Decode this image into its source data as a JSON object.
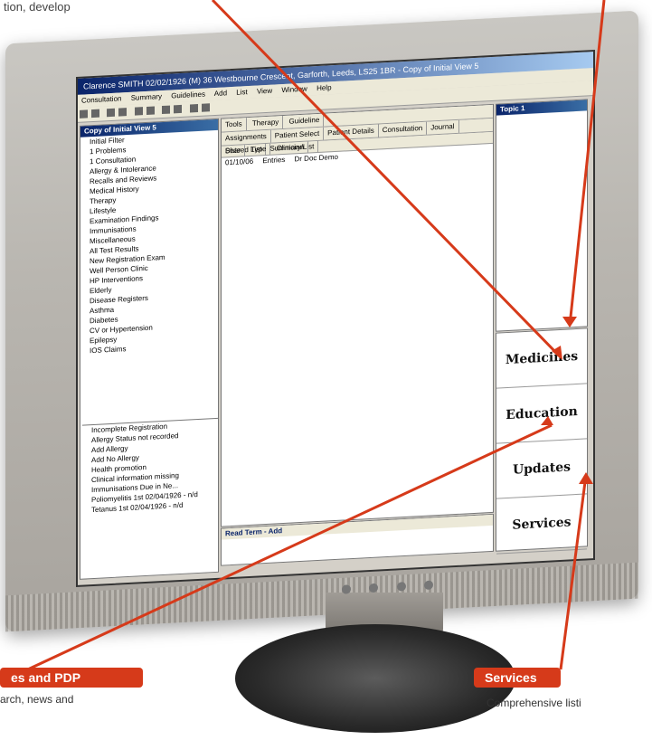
{
  "top_caption": "tion, develop",
  "window": {
    "title": "Clarence SMITH 02/02/1926 (M) 36 Westbourne Crescent, Garforth, Leeds, LS25 1BR - Copy of Initial View 5"
  },
  "menu": [
    "Consultation",
    "Summary",
    "Guidelines",
    "Add",
    "List",
    "View",
    "Window",
    "Help"
  ],
  "left_pane": {
    "title": "Copy of Initial View 5",
    "items": [
      "Initial Filter",
      "1 Problems",
      "1 Consultation",
      "Allergy & Intolerance",
      "Recalls and Reviews",
      "Medical History",
      "Therapy",
      "Lifestyle",
      "Examination Findings",
      "Immunisations",
      "Miscellaneous",
      "All Test Results",
      "New Registration Exam",
      "Well Person Clinic",
      "HP Interventions",
      "Elderly",
      "Disease Registers",
      "Asthma",
      "Diabetes",
      "CV or Hypertension",
      "Epilepsy",
      "IOS Claims"
    ]
  },
  "alerts": {
    "items": [
      "Incomplete Registration",
      "Allergy Status not recorded",
      "Add Allergy",
      "Add No Allergy",
      "Health promotion",
      "Clinical information missing",
      "Immunisations Due in Ne...",
      "Poliomyelitis 1st 02/04/1926 - n/d",
      "Tetanus 1st 02/04/1926 - n/d"
    ]
  },
  "main": {
    "tab_groups": [
      "Tools",
      "Therapy",
      "Guideline"
    ],
    "tabs": [
      "Assignments",
      "Patient Select",
      "Patient Details",
      "Consultation",
      "Journal",
      "Shared List",
      "Summary/List"
    ],
    "columns": [
      "Date",
      "Type",
      "Clinician"
    ],
    "rows": [
      {
        "date": "01/10/06",
        "type": "Entries",
        "clinician": "Dr Doc Demo"
      }
    ]
  },
  "read_term": {
    "title": "Read Term - Add"
  },
  "right_pane": {
    "title": "Topic 1"
  },
  "ads": [
    "Medicines",
    "Education",
    "Updates",
    "Services"
  ],
  "labels": {
    "left_label": "es and PDP",
    "left_caption": "arch, news and",
    "right_label": "Services",
    "right_caption": "Comprehensive listi"
  },
  "colors": {
    "accent_red": "#d63a1a",
    "titlebar_blue": "#0a246a"
  }
}
